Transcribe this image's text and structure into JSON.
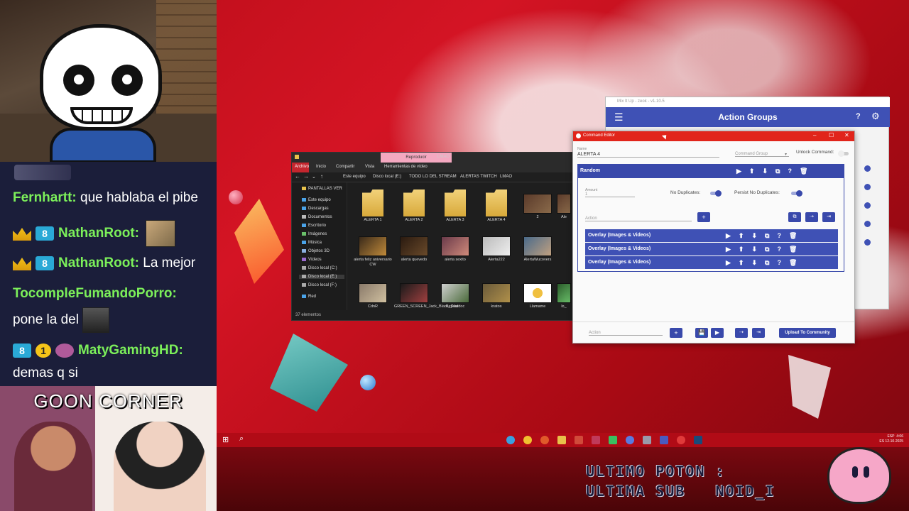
{
  "chat": {
    "lines": [
      {
        "user": "Fernhartt:",
        "text": " que hablaba el pibe"
      },
      {
        "user": "NathanRoot:",
        "text": ""
      },
      {
        "user": "NathanRoot:",
        "text": " La mejor"
      },
      {
        "user": "TocompleFumandoPorro:",
        "text": ""
      },
      {
        "user": "",
        "text": "pone la del"
      },
      {
        "user": "MatyGamingHD:",
        "text": ""
      },
      {
        "user": "",
        "text": "demas q si"
      }
    ],
    "badge_one": "1"
  },
  "goon_title": "GOON CORNER",
  "explorer": {
    "title": "LMAO",
    "context_tab": "Reproducir",
    "ribbon_tabs": [
      "Archivo",
      "Inicio",
      "Compartir",
      "Vista",
      "Herramientas de vídeo"
    ],
    "breadcrumbs": [
      "Este equipo",
      "Disco local (E:)",
      "TODO LO DEL STREAM",
      "ALERTAS TWITCH",
      "LMAO"
    ],
    "nav_items": [
      "PANTALLAS VER",
      "Este equipo",
      "Descargas",
      "Documentos",
      "Escritorio",
      "Imágenes",
      "Música",
      "Objetos 3D",
      "Vídeos",
      "Disco local (C:)",
      "Disco local (E:)",
      "Disco local (F:)",
      "Red"
    ],
    "files_row1": [
      "ALERTA 1",
      "ALERTA 2",
      "ALERTA 3",
      "ALERTA 4",
      "2",
      "Ale"
    ],
    "files_row2": [
      "alerta feliz aniversario CW",
      "alerta quevedo",
      "alerta sexito",
      "Alerta222",
      "AlertaWucovers",
      ""
    ],
    "files_row3": [
      "CdnR",
      "GREEN_SCREEN_Jack_Black_Saul",
      "KayVardoc",
      "kratos",
      "Llamame",
      "lo_"
    ],
    "status": "37 elementos"
  },
  "mixitup": {
    "title": "Mix It Up - zeok - v1.10.5",
    "header": "Action Groups"
  },
  "editor": {
    "title": "Command Editor",
    "name_caption": "Name",
    "name_value": "ALERTA 4",
    "group_placeholder": "Command Group",
    "unlock_label": "Unlock Command:",
    "action_type": "Random",
    "amount_caption": "Amount",
    "amount_value": "1",
    "no_duplicates_label": "No Duplicates:",
    "persist_label": "Persist No Duplicates:",
    "action_placeholder": "Action",
    "sub_actions": [
      "Overlay (Images & Videos)",
      "Overlay (Images & Videos)",
      "Overlay (Images & Videos)"
    ],
    "bottom_action_placeholder": "Action",
    "upload_label": "Upload To Community"
  },
  "taskbar": {
    "tray_lang": "ESP",
    "tray_region": "ES",
    "tray_time": "4:06",
    "tray_date": "12-10-2025"
  },
  "bottom_text": {
    "line1": "ULTIMO POTON :",
    "line2": "ULTIMA SUB   NOID_I"
  },
  "colors": {
    "accent": "#3949ab",
    "editor_title": "#e1251b",
    "taskbar": "#b10b16",
    "chat_user": "#7cf05a"
  }
}
